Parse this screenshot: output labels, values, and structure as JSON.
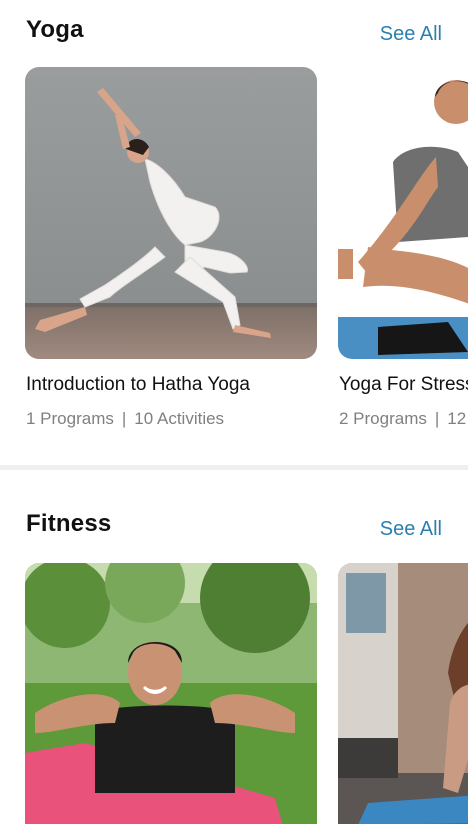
{
  "sections": [
    {
      "title": "Yoga",
      "see_all": "See All",
      "cards": [
        {
          "title": "Introduction to Hatha Yoga",
          "programs": "1 Programs",
          "activities": "10 Activities"
        },
        {
          "title": "Yoga For Stress",
          "programs": "2 Programs",
          "activities": "12"
        }
      ]
    },
    {
      "title": "Fitness",
      "see_all": "See All",
      "cards": [
        {
          "title": "",
          "programs": "",
          "activities": ""
        },
        {
          "title": "",
          "programs": "",
          "activities": ""
        }
      ]
    }
  ],
  "meta_separator": "|",
  "colors": {
    "accent": "#2b7fb0",
    "divider": "#efefef",
    "meta": "#808080"
  }
}
